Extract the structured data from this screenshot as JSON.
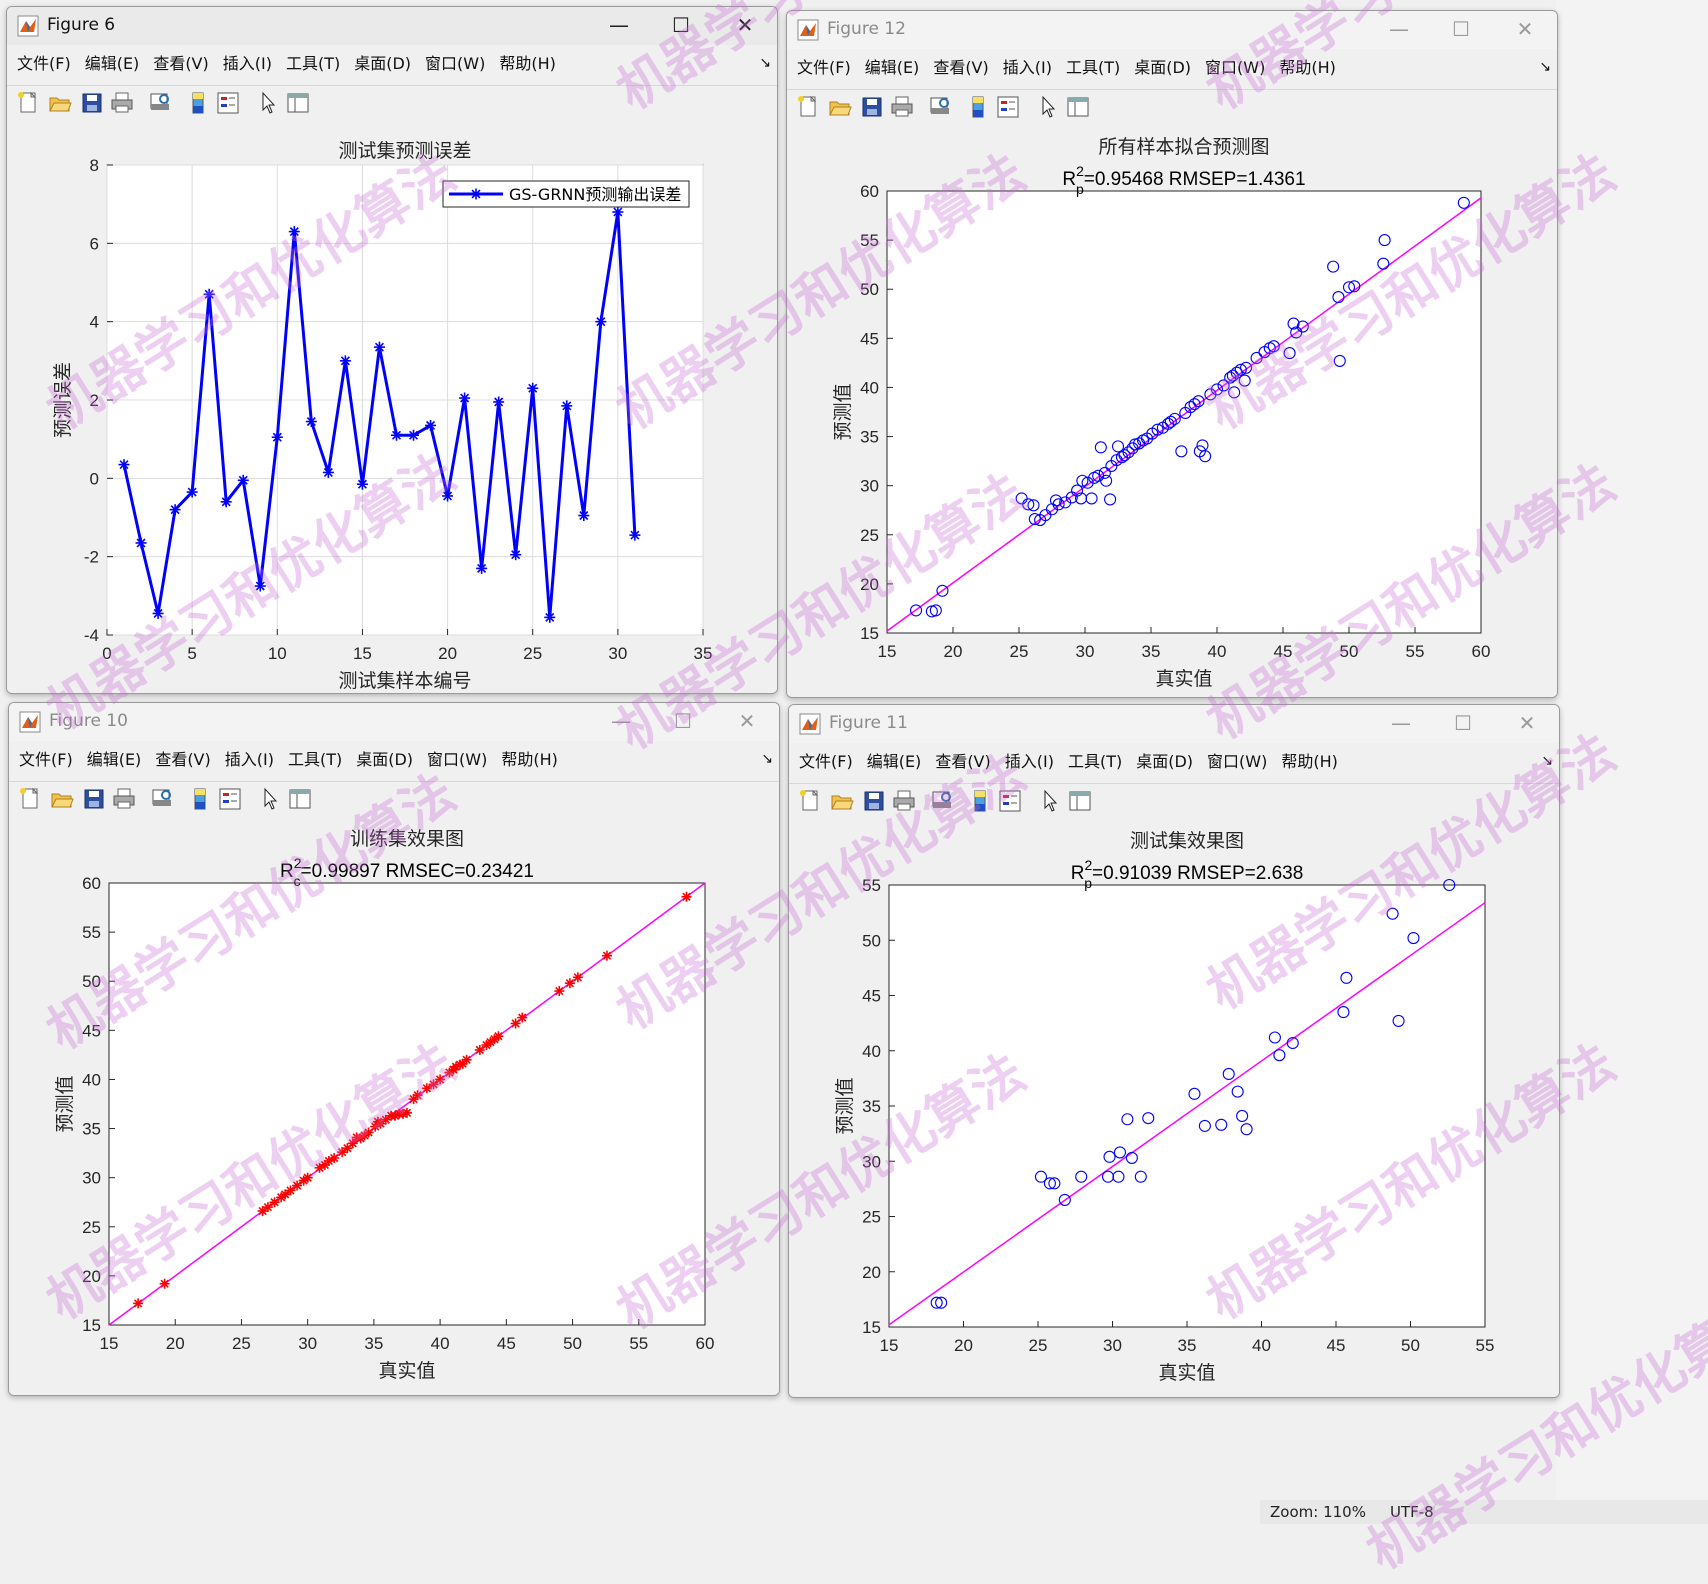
{
  "windows": {
    "w6": {
      "title": "Figure 6"
    },
    "w12": {
      "title": "Figure 12"
    },
    "w10": {
      "title": "Figure 10"
    },
    "w11": {
      "title": "Figure 11"
    }
  },
  "menus": [
    "文件(F)",
    "编辑(E)",
    "查看(V)",
    "插入(I)",
    "工具(T)",
    "桌面(D)",
    "窗口(W)",
    "帮助(H)"
  ],
  "window_controls": {
    "minimize": "—",
    "maximize": "☐",
    "close": "✕"
  },
  "toolbar_icons": [
    "new-figure-icon",
    "open-icon",
    "save-icon",
    "print-icon",
    "print-preview-icon",
    "colorbar-icon",
    "legend-icon",
    "pointer-icon",
    "property-editor-icon"
  ],
  "watermark": "机器学习和优化算法",
  "status": {
    "zoom": "Zoom: 110%",
    "encoding": "UTF-8"
  },
  "colors": {
    "series_blue": "#0000ff",
    "fit_line": "#ff00ff",
    "train_marker": "#ff0000",
    "grid": "#dcdcdc"
  },
  "chart_data": [
    {
      "id": "fig6",
      "type": "line",
      "title": "测试集预测误差",
      "xlabel": "测试集样本编号",
      "ylabel": "预测误差",
      "xlim": [
        0,
        35
      ],
      "ylim": [
        -4,
        8
      ],
      "xticks": [
        0,
        5,
        10,
        15,
        20,
        25,
        30,
        35
      ],
      "yticks": [
        -4,
        -2,
        0,
        2,
        4,
        6,
        8
      ],
      "grid": true,
      "legend_position": "top-right",
      "series": [
        {
          "name": "GS-GRNN预测输出误差",
          "marker": "*",
          "color": "#0000ff",
          "x": [
            1,
            2,
            3,
            4,
            5,
            6,
            7,
            8,
            9,
            10,
            11,
            12,
            13,
            14,
            15,
            16,
            17,
            18,
            19,
            20,
            21,
            22,
            23,
            24,
            25,
            26,
            27,
            28,
            29,
            30,
            31
          ],
          "y": [
            0.35,
            -1.65,
            -3.45,
            -0.8,
            -0.35,
            4.7,
            -0.6,
            -0.05,
            -2.75,
            1.05,
            6.3,
            1.45,
            0.15,
            3.0,
            -0.15,
            3.35,
            1.1,
            1.1,
            1.35,
            -0.45,
            2.05,
            -2.3,
            1.95,
            -1.95,
            2.3,
            -3.55,
            1.85,
            -0.95,
            4.0,
            6.8,
            -1.45
          ]
        }
      ]
    },
    {
      "id": "fig12",
      "type": "scatter",
      "title": "所有样本拟合预测图",
      "subtitle": "R_p^2=0.95468  RMSEP=1.4361",
      "subtitle_parts": {
        "base": "R",
        "sup": "2",
        "sub": "p",
        "rest": "=0.95468  RMSEP=1.4361"
      },
      "xlabel": "真实值",
      "ylabel": "预测值",
      "xlim": [
        15,
        60
      ],
      "ylim": [
        15,
        60
      ],
      "ticks": [
        15,
        20,
        25,
        30,
        35,
        40,
        45,
        50,
        55,
        60
      ],
      "grid": false,
      "marker": "o",
      "color": "#0000ff",
      "fit_line": [
        [
          15,
          15.2
        ],
        [
          60,
          59.3
        ]
      ],
      "points": [
        [
          17.2,
          17.3
        ],
        [
          18.4,
          17.2
        ],
        [
          18.7,
          17.3
        ],
        [
          19.2,
          19.3
        ],
        [
          25.2,
          28.7
        ],
        [
          25.7,
          28.1
        ],
        [
          26.1,
          28.0
        ],
        [
          26.2,
          26.6
        ],
        [
          26.6,
          26.5
        ],
        [
          27.0,
          27.0
        ],
        [
          27.5,
          27.6
        ],
        [
          27.8,
          28.5
        ],
        [
          28.0,
          28.1
        ],
        [
          28.5,
          28.3
        ],
        [
          29.0,
          28.8
        ],
        [
          29.4,
          29.5
        ],
        [
          29.7,
          28.7
        ],
        [
          29.8,
          30.5
        ],
        [
          30.2,
          30.3
        ],
        [
          30.5,
          28.7
        ],
        [
          30.7,
          30.8
        ],
        [
          31.0,
          31.0
        ],
        [
          31.2,
          33.9
        ],
        [
          31.5,
          31.3
        ],
        [
          31.6,
          30.5
        ],
        [
          31.9,
          28.6
        ],
        [
          32.0,
          32.0
        ],
        [
          32.4,
          32.6
        ],
        [
          32.5,
          34.0
        ],
        [
          32.8,
          32.9
        ],
        [
          33.0,
          33.1
        ],
        [
          33.3,
          33.4
        ],
        [
          33.6,
          33.8
        ],
        [
          33.8,
          34.2
        ],
        [
          34.1,
          34.3
        ],
        [
          34.4,
          34.6
        ],
        [
          34.7,
          34.8
        ],
        [
          35.1,
          35.3
        ],
        [
          35.5,
          35.7
        ],
        [
          35.9,
          35.9
        ],
        [
          36.3,
          36.3
        ],
        [
          36.5,
          36.5
        ],
        [
          36.8,
          36.8
        ],
        [
          37.3,
          33.5
        ],
        [
          37.6,
          37.4
        ],
        [
          38.0,
          38.0
        ],
        [
          38.3,
          38.3
        ],
        [
          38.6,
          38.6
        ],
        [
          38.7,
          33.5
        ],
        [
          38.9,
          34.1
        ],
        [
          39.1,
          33.0
        ],
        [
          39.5,
          39.3
        ],
        [
          40.0,
          39.8
        ],
        [
          40.5,
          40.2
        ],
        [
          41.0,
          41.0
        ],
        [
          41.2,
          41.2
        ],
        [
          41.3,
          39.5
        ],
        [
          41.5,
          41.5
        ],
        [
          41.8,
          41.8
        ],
        [
          42.1,
          40.7
        ],
        [
          42.2,
          42.0
        ],
        [
          43.0,
          43.0
        ],
        [
          43.6,
          43.6
        ],
        [
          44.0,
          44.0
        ],
        [
          44.3,
          44.2
        ],
        [
          45.5,
          43.5
        ],
        [
          45.8,
          46.5
        ],
        [
          46.0,
          45.6
        ],
        [
          46.5,
          46.2
        ],
        [
          48.8,
          52.3
        ],
        [
          49.2,
          49.2
        ],
        [
          49.3,
          42.7
        ],
        [
          50.0,
          50.2
        ],
        [
          50.4,
          50.3
        ],
        [
          52.6,
          52.6
        ],
        [
          52.7,
          55.0
        ],
        [
          58.7,
          58.8
        ]
      ]
    },
    {
      "id": "fig10",
      "type": "scatter",
      "title": "训练集效果图",
      "subtitle": "R_c^2=0.99897  RMSEC=0.23421",
      "subtitle_parts": {
        "base": "R",
        "sup": "2",
        "sub": "c",
        "rest": "=0.99897  RMSEC=0.23421"
      },
      "xlabel": "真实值",
      "ylabel": "预测值",
      "xlim": [
        15,
        60
      ],
      "ylim": [
        15,
        60
      ],
      "ticks": [
        15,
        20,
        25,
        30,
        35,
        40,
        45,
        50,
        55,
        60
      ],
      "grid": false,
      "marker": "*",
      "color": "#ff0000",
      "fit_line": [
        [
          15,
          15.0
        ],
        [
          60,
          60.0
        ]
      ],
      "points": [
        [
          17.2,
          17.2
        ],
        [
          19.2,
          19.2
        ],
        [
          26.6,
          26.6
        ],
        [
          27.0,
          27.0
        ],
        [
          27.5,
          27.5
        ],
        [
          28.0,
          28.0
        ],
        [
          28.3,
          28.3
        ],
        [
          28.7,
          28.7
        ],
        [
          29.2,
          29.2
        ],
        [
          29.7,
          29.7
        ],
        [
          30.0,
          30.0
        ],
        [
          30.9,
          31.0
        ],
        [
          31.3,
          31.3
        ],
        [
          31.6,
          31.7
        ],
        [
          32.0,
          32.0
        ],
        [
          32.6,
          32.6
        ],
        [
          33.0,
          33.0
        ],
        [
          33.4,
          33.5
        ],
        [
          33.7,
          34.1
        ],
        [
          34.0,
          34.0
        ],
        [
          34.3,
          34.3
        ],
        [
          34.6,
          34.6
        ],
        [
          35.1,
          35.2
        ],
        [
          35.3,
          35.7
        ],
        [
          35.5,
          35.5
        ],
        [
          35.9,
          35.9
        ],
        [
          36.3,
          36.3
        ],
        [
          36.6,
          36.3
        ],
        [
          36.9,
          36.5
        ],
        [
          37.2,
          36.5
        ],
        [
          37.5,
          36.6
        ],
        [
          38.0,
          38.0
        ],
        [
          38.3,
          38.4
        ],
        [
          39.0,
          39.1
        ],
        [
          39.5,
          39.5
        ],
        [
          40.0,
          40.0
        ],
        [
          40.7,
          40.7
        ],
        [
          41.0,
          41.0
        ],
        [
          41.2,
          41.3
        ],
        [
          41.5,
          41.5
        ],
        [
          41.7,
          41.6
        ],
        [
          42.0,
          42.0
        ],
        [
          43.0,
          43.0
        ],
        [
          43.5,
          43.5
        ],
        [
          43.8,
          43.8
        ],
        [
          44.1,
          44.1
        ],
        [
          44.4,
          44.4
        ],
        [
          45.7,
          45.7
        ],
        [
          46.2,
          46.3
        ],
        [
          49.0,
          49.0
        ],
        [
          49.8,
          49.8
        ],
        [
          50.4,
          50.4
        ],
        [
          52.6,
          52.6
        ],
        [
          58.6,
          58.6
        ]
      ]
    },
    {
      "id": "fig11",
      "type": "scatter",
      "title": "测试集效果图",
      "subtitle": "R_p^2=0.91039  RMSEP=2.638",
      "subtitle_parts": {
        "base": "R",
        "sup": "2",
        "sub": "p",
        "rest": "=0.91039  RMSEP=2.638"
      },
      "xlabel": "真实值",
      "ylabel": "预测值",
      "xlim": [
        15,
        55
      ],
      "ylim": [
        15,
        55
      ],
      "ticks": [
        15,
        20,
        25,
        30,
        35,
        40,
        45,
        50,
        55
      ],
      "grid": false,
      "marker": "o",
      "color": "#0000ff",
      "fit_line": [
        [
          15,
          15.2
        ],
        [
          55,
          53.4
        ]
      ],
      "points": [
        [
          18.2,
          17.2
        ],
        [
          18.5,
          17.2
        ],
        [
          25.2,
          28.6
        ],
        [
          25.8,
          28.0
        ],
        [
          26.1,
          28.0
        ],
        [
          26.8,
          26.5
        ],
        [
          27.9,
          28.6
        ],
        [
          29.7,
          28.6
        ],
        [
          29.8,
          30.4
        ],
        [
          30.4,
          28.6
        ],
        [
          30.5,
          30.8
        ],
        [
          31.0,
          33.8
        ],
        [
          31.3,
          30.3
        ],
        [
          31.9,
          28.6
        ],
        [
          32.4,
          33.9
        ],
        [
          35.5,
          36.1
        ],
        [
          36.2,
          33.2
        ],
        [
          37.3,
          33.3
        ],
        [
          37.8,
          37.9
        ],
        [
          38.4,
          36.3
        ],
        [
          38.7,
          34.1
        ],
        [
          39.0,
          32.9
        ],
        [
          40.9,
          41.2
        ],
        [
          41.2,
          39.6
        ],
        [
          42.1,
          40.7
        ],
        [
          45.5,
          43.5
        ],
        [
          45.7,
          46.6
        ],
        [
          48.8,
          52.4
        ],
        [
          49.2,
          42.7
        ],
        [
          50.2,
          50.2
        ],
        [
          52.6,
          55.0
        ]
      ]
    }
  ]
}
